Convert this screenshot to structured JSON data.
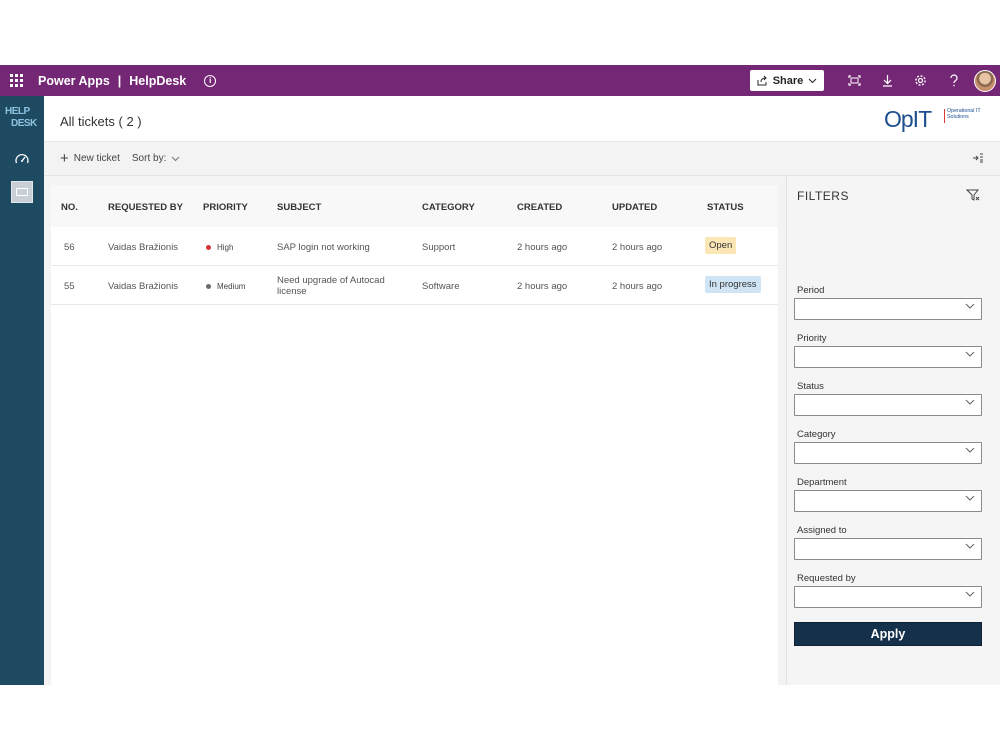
{
  "topbar": {
    "app_name": "Power Apps",
    "separator": "|",
    "app_title": "HelpDesk",
    "info_glyph": "i",
    "share_label": "Share",
    "icons": [
      "waffle-icon",
      "info-icon",
      "share-icon",
      "chevron-down-icon",
      "fit-screen-icon",
      "download-icon",
      "gear-icon",
      "help-icon",
      "avatar"
    ],
    "color": "#742774"
  },
  "rail": {
    "logo_line1": "HELP",
    "logo_line2": "DESK",
    "items": [
      "dashboard-icon",
      "tickets-icon"
    ],
    "color": "#1e4a62"
  },
  "header": {
    "title": "All tickets ( 2 )",
    "brand_mark": "OpIT",
    "brand_tagline": "Operational IT Solutions"
  },
  "toolbar": {
    "new_ticket": "New ticket",
    "sort_by": "Sort by:"
  },
  "table": {
    "columns": [
      "NO.",
      "REQUESTED BY",
      "PRIORITY",
      "SUBJECT",
      "CATEGORY",
      "CREATED",
      "UPDATED",
      "STATUS"
    ],
    "rows": [
      {
        "no": "56",
        "requested_by": "Vaidas Bražionis",
        "priority": "High",
        "priority_color": "#d13438",
        "subject_line1": "SAP login not working",
        "subject_line2": "",
        "category": "Support",
        "created": "2 hours ago",
        "updated": "2 hours ago",
        "status": "Open",
        "status_color": "#fbe7b5"
      },
      {
        "no": "55",
        "requested_by": "Vaidas Bražionis",
        "priority": "Medium",
        "priority_color": "#6b6b6b",
        "subject_line1": "Need upgrade of Autocad",
        "subject_line2": "license",
        "category": "Software",
        "created": "2 hours ago",
        "updated": "2 hours ago",
        "status": "In progress",
        "status_color": "#cfe4f4"
      }
    ]
  },
  "filters": {
    "title": "FILTERS",
    "fields": [
      "Period",
      "Priority",
      "Status",
      "Category",
      "Department",
      "Assigned to",
      "Requested by"
    ],
    "apply_label": "Apply",
    "apply_color": "#14304a"
  }
}
